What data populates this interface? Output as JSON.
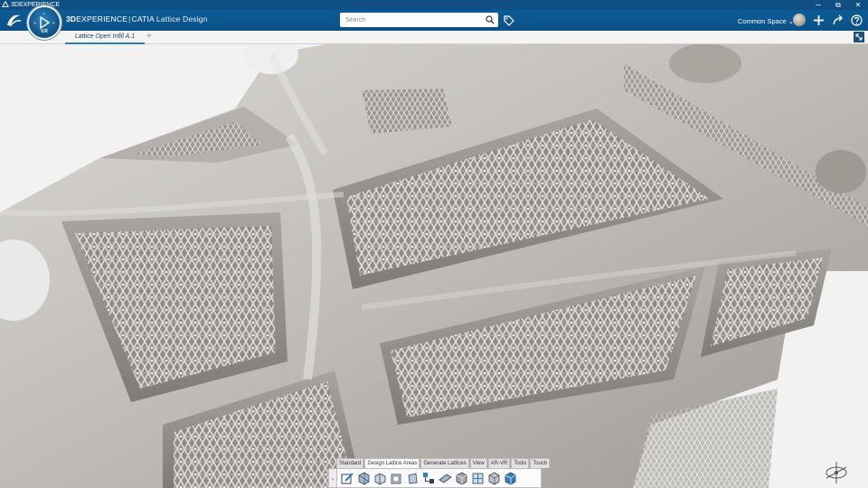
{
  "window": {
    "title": "3DEXPERIENCE",
    "minimize": "─",
    "restore": "⧉",
    "close": "✕"
  },
  "topbar": {
    "brand_bold": "3D",
    "brand_rest": "EXPERIENCE",
    "separator": "|",
    "product": "CATIA",
    "app_name": "Lattice Design",
    "search_placeholder": "Search",
    "space_label": "Common Space",
    "space_chevron": "⌄"
  },
  "compass": {
    "version": "V.R"
  },
  "tabs": [
    {
      "label": "Lattice Open Infill A.1",
      "active": true
    }
  ],
  "tab_add": "+",
  "actionbar": {
    "handle": "⌄",
    "sections": [
      {
        "label": "Standard",
        "active": false
      },
      {
        "label": "Design Lattice Areas",
        "active": true
      },
      {
        "label": "Generate Lattices",
        "active": false
      },
      {
        "label": "View",
        "active": false
      },
      {
        "label": "AR-VR",
        "active": false
      },
      {
        "label": "Tools",
        "active": false
      },
      {
        "label": "Touch",
        "active": false
      }
    ],
    "tools": [
      "edit-sketch-icon",
      "lattice-area-icon",
      "split-body-icon",
      "shell-icon",
      "offset-face-icon",
      "lattice-tree-icon",
      "slice-plane-icon",
      "cube-lattice-icon",
      "conform-lattice-icon",
      "solid-block-icon",
      "render-cube-icon"
    ]
  },
  "colors": {
    "titlebar": "#0f4f83",
    "topbar": "#0d5c96",
    "accent": "#2d7fc1",
    "part_metal": "#b7b4af"
  }
}
